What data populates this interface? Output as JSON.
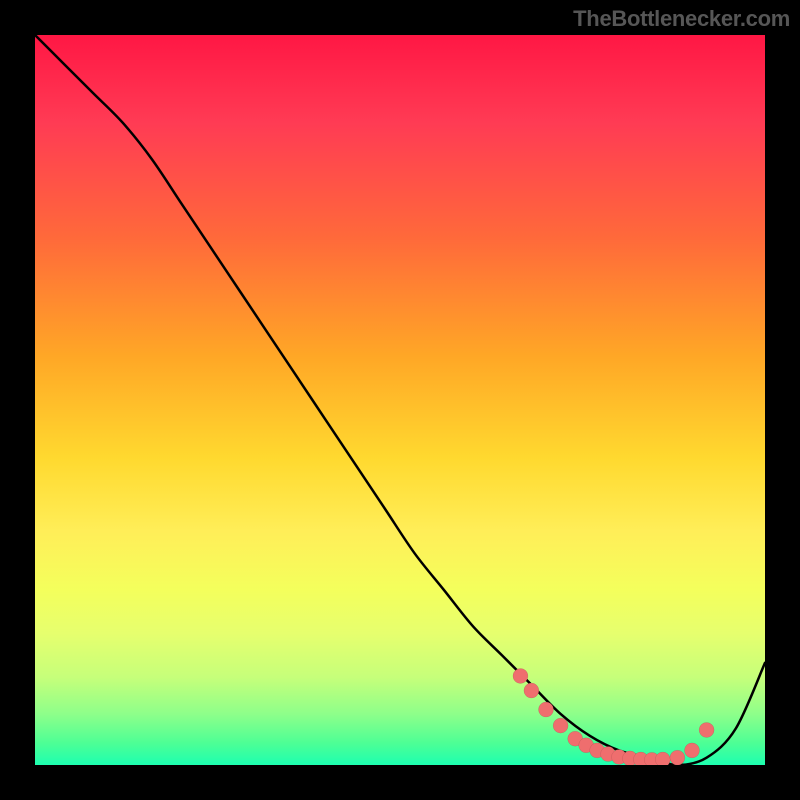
{
  "attribution": "TheBottlenecker.com",
  "chart_data": {
    "type": "line",
    "title": "",
    "xlabel": "",
    "ylabel": "",
    "xlim": [
      0,
      100
    ],
    "ylim": [
      0,
      100
    ],
    "series": [
      {
        "name": "bottleneck-curve",
        "x": [
          0,
          4,
          8,
          12,
          16,
          20,
          24,
          28,
          32,
          36,
          40,
          44,
          48,
          52,
          56,
          60,
          64,
          68,
          72,
          76,
          80,
          84,
          88,
          92,
          96,
          100
        ],
        "y": [
          100,
          96,
          92,
          88,
          83,
          77,
          71,
          65,
          59,
          53,
          47,
          41,
          35,
          29,
          24,
          19,
          15,
          11,
          7,
          4,
          2,
          1,
          0,
          1,
          5,
          14
        ]
      }
    ],
    "markers": {
      "name": "optimal-zone-markers",
      "x": [
        66.5,
        68,
        70,
        72,
        74,
        75.5,
        77,
        78.5,
        80,
        81.5,
        83,
        84.5,
        86,
        88,
        90,
        92
      ],
      "y": [
        12.2,
        10.2,
        7.6,
        5.4,
        3.6,
        2.7,
        2.0,
        1.5,
        1.1,
        0.9,
        0.75,
        0.7,
        0.75,
        1.0,
        2.0,
        4.8
      ]
    },
    "background_gradient": {
      "top": "#ff1744",
      "mid": "#ffee58",
      "bottom": "#1dffb0"
    }
  }
}
